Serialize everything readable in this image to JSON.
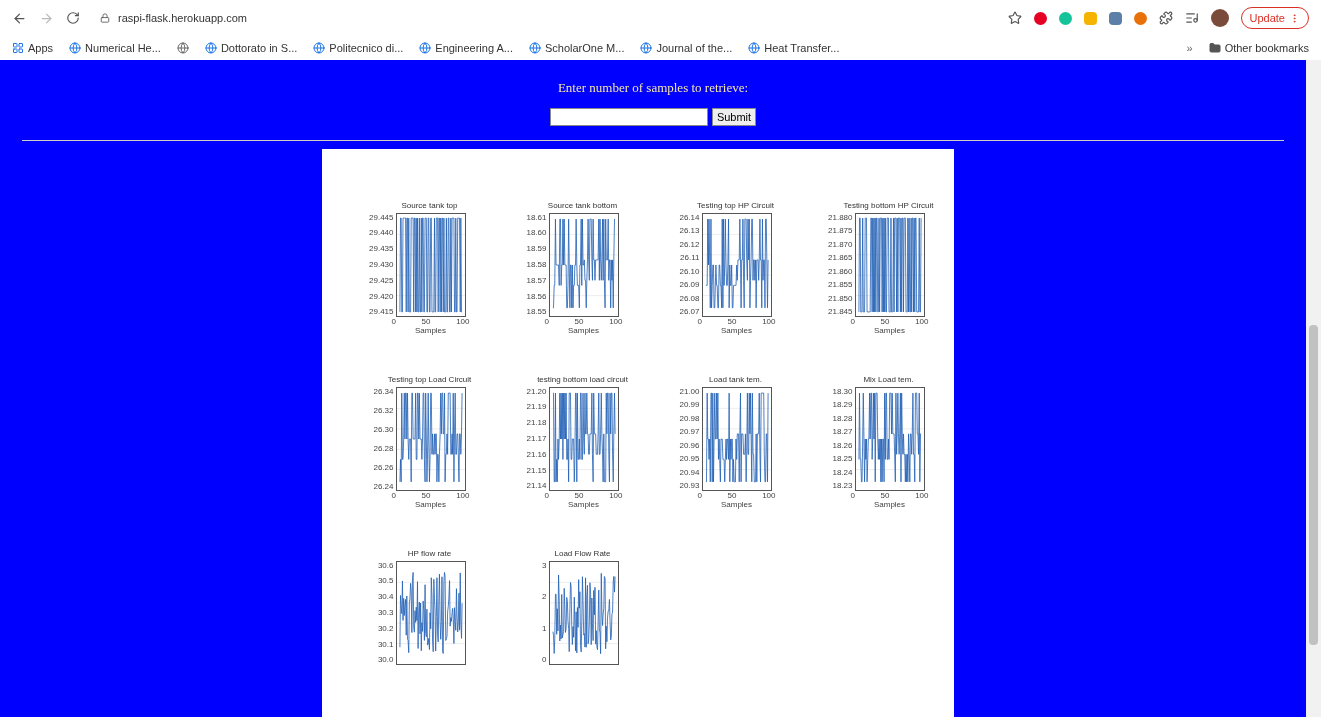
{
  "browser": {
    "url": "raspi-flask.herokuapp.com",
    "update_button": "Update",
    "more_bookmarks": "»",
    "other_bookmarks": "Other bookmarks",
    "bookmarks": [
      {
        "kind": "apps",
        "label": "Apps"
      },
      {
        "kind": "page",
        "label": "Numerical He..."
      },
      {
        "kind": "icon"
      },
      {
        "kind": "page",
        "label": "Dottorato in S..."
      },
      {
        "kind": "page",
        "label": "Politecnico di..."
      },
      {
        "kind": "page",
        "label": "Engineering A..."
      },
      {
        "kind": "page",
        "label": "ScholarOne M..."
      },
      {
        "kind": "page",
        "label": "Journal of the..."
      },
      {
        "kind": "page",
        "label": "Heat Transfer..."
      }
    ]
  },
  "form": {
    "prompt": "Enter number of samples to retrieve:",
    "submit": "Submit"
  },
  "plots": [
    {
      "title": "Source tank top",
      "yticks": [
        "29.445",
        "29.440",
        "29.435",
        "29.430",
        "29.425",
        "29.420",
        "29.415"
      ],
      "xticks": [
        "0",
        "50",
        "100"
      ],
      "xlabel": "Samples"
    },
    {
      "title": "Source tank bottom",
      "yticks": [
        "18.61",
        "18.60",
        "18.59",
        "18.58",
        "18.57",
        "18.56",
        "18.55"
      ],
      "xticks": [
        "0",
        "50",
        "100"
      ],
      "xlabel": "Samples"
    },
    {
      "title": "Testing top HP Circuit",
      "yticks": [
        "26.14",
        "26.13",
        "26.12",
        "26.11",
        "26.10",
        "26.09",
        "26.08",
        "26.07"
      ],
      "xticks": [
        "0",
        "50",
        "100"
      ],
      "xlabel": "Samples"
    },
    {
      "title": "Testing bottom HP Circuit",
      "yticks": [
        "21.880",
        "21.875",
        "21.870",
        "21.865",
        "21.860",
        "21.855",
        "21.850",
        "21.845"
      ],
      "xticks": [
        "0",
        "50",
        "100"
      ],
      "xlabel": "Samples"
    },
    {
      "title": "Testing top Load Circuit",
      "yticks": [
        "26.34",
        "26.32",
        "26.30",
        "26.28",
        "26.26",
        "26.24"
      ],
      "xticks": [
        "0",
        "50",
        "100"
      ],
      "xlabel": "Samples"
    },
    {
      "title": "testing bottom load circuit",
      "yticks": [
        "21.20",
        "21.19",
        "21.18",
        "21.17",
        "21.16",
        "21.15",
        "21.14"
      ],
      "xticks": [
        "0",
        "50",
        "100"
      ],
      "xlabel": "Samples"
    },
    {
      "title": "Load tank tem.",
      "yticks": [
        "21.00",
        "20.99",
        "20.98",
        "20.97",
        "20.96",
        "20.95",
        "20.94",
        "20.93"
      ],
      "xticks": [
        "0",
        "50",
        "100"
      ],
      "xlabel": "Samples"
    },
    {
      "title": "Mix Load tem.",
      "yticks": [
        "18.30",
        "18.29",
        "18.28",
        "18.27",
        "18.26",
        "18.25",
        "18.24",
        "18.23"
      ],
      "xticks": [
        "0",
        "50",
        "100"
      ],
      "xlabel": "Samples"
    },
    {
      "title": "HP flow rate",
      "yticks": [
        "30.6",
        "30.5",
        "30.4",
        "30.3",
        "30.2",
        "30.1",
        "30.0"
      ]
    },
    {
      "title": "Load Flow Rate",
      "yticks": [
        "3",
        "2",
        "1",
        "0"
      ]
    }
  ]
}
